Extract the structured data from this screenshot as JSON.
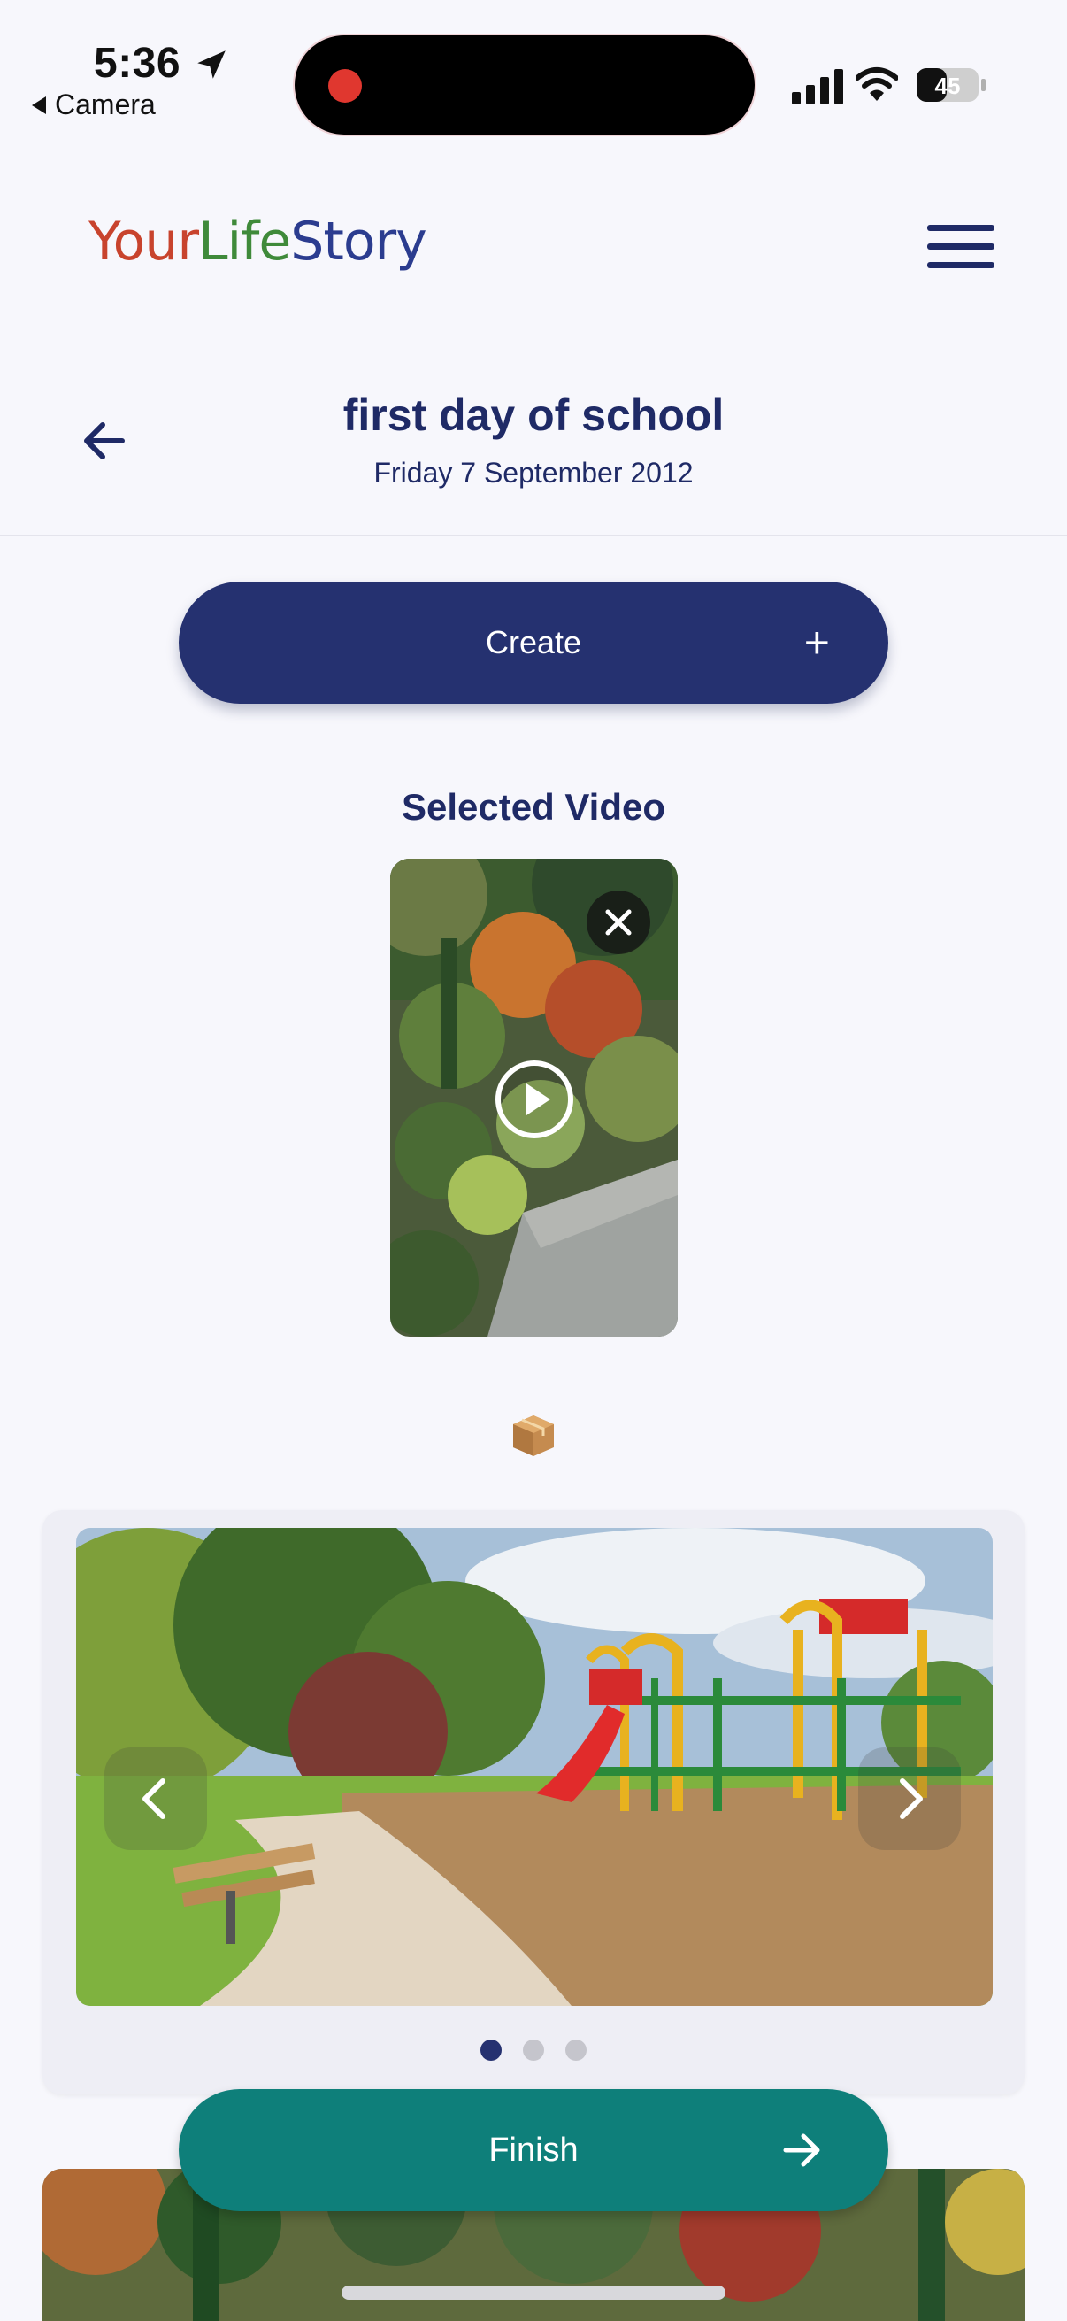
{
  "status_bar": {
    "time": "5:36",
    "back_app": "Camera",
    "battery": "45"
  },
  "header": {
    "logo_part1": "Your",
    "logo_part2": "Life",
    "logo_part3": "Story"
  },
  "event": {
    "title": "first day of school",
    "date": "Friday 7 September 2012"
  },
  "create_button": {
    "label": "Create",
    "icon": "plus-icon"
  },
  "selected_video": {
    "heading": "Selected Video"
  },
  "carousel": {
    "slides": 3,
    "active_index": 0
  },
  "finish_button": {
    "label": "Finish",
    "icon": "arrow-right-icon"
  },
  "colors": {
    "primary": "#253170",
    "finish": "#0e7f7a",
    "logo_your": "#c8432d",
    "logo_life": "#3f8a3a",
    "logo_story": "#2b3c8f"
  }
}
